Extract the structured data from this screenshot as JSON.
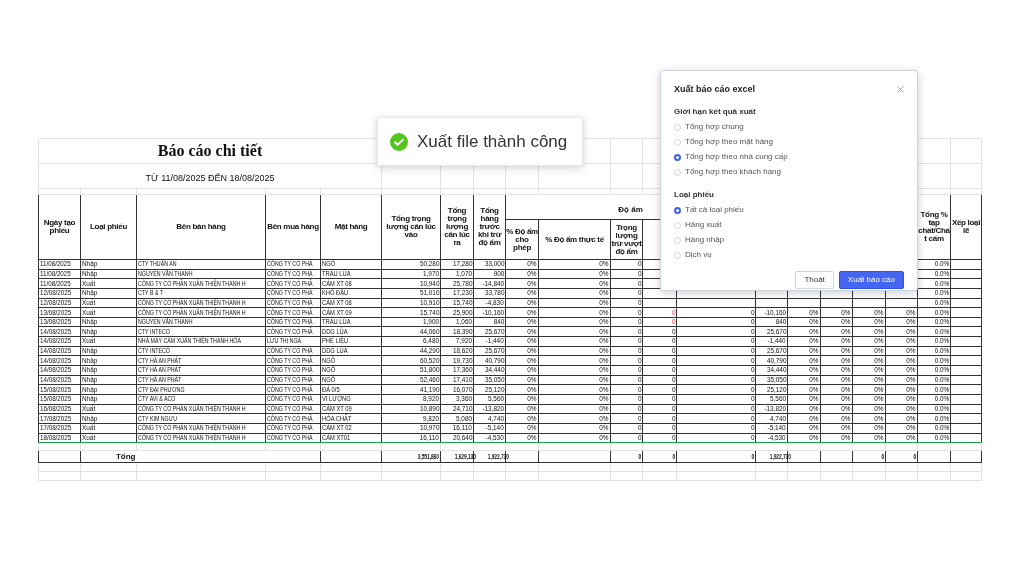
{
  "report": {
    "title": "Báo cáo chi tiết",
    "subtitle": "TỪ 11/08/2025 ĐẾN 18/08/2025",
    "group_header": "Độ ẩm",
    "columns": [
      "Ngày tạo phiếu",
      "Loại phiếu",
      "Bên bán hàng",
      "Bên mua hàng",
      "Mặt hàng",
      "Tổng trọng lượng cân lúc vào",
      "Tổng trọng lượng cân lúc ra",
      "Tổng hàng trước khi trừ độ ẩm",
      "% Độ ẩm cho phép",
      "% Độ ẩm thực tế",
      "Trọng lượng trừ vượt độ ẩm",
      null,
      null,
      null,
      null,
      null,
      null,
      null,
      "Tổng % tạp chất/Chất cấm",
      "Xếp loại lẽ"
    ],
    "rows": [
      {
        "cells": [
          "11/08/2025",
          "Nhập",
          "CTY THUẬN AN",
          "CÔNG TY CỔ PHẦ",
          "NGÔ",
          "50,280",
          "17,280",
          "33,000",
          "0%",
          "0%",
          "0",
          null,
          null,
          null,
          null,
          null,
          null,
          null,
          "0.0%"
        ]
      },
      {
        "cells": [
          "11/08/2025",
          "Nhập",
          "NGUYỄN VĂN THANH",
          "CÔNG TY CỔ PHẦ",
          "TRẤU LÚA",
          "1,970",
          "1,070",
          "900",
          "0%",
          "0%",
          "0",
          null,
          null,
          null,
          null,
          null,
          null,
          null,
          "0.0%"
        ]
      },
      {
        "cells": [
          "11/08/2025",
          "Xuất",
          "CÔNG TY CỔ PHẦN XUÂN THIỆN THANH H",
          "CÔNG TY CỔ PHẦ",
          "CÁM XT 08",
          "10,940",
          "25,780",
          "-14,840",
          "0%",
          "0%",
          "0",
          null,
          null,
          null,
          null,
          null,
          null,
          null,
          "0.0%"
        ]
      },
      {
        "cells": [
          "12/08/2025",
          "Nhập",
          "CTY B & T",
          "CÔNG TY CỔ PHẦ",
          "KHÔ ĐẬU",
          "51,010",
          "17,230",
          "33,780",
          "0%",
          "0%",
          "0",
          null,
          null,
          null,
          null,
          null,
          null,
          null,
          "0.0%"
        ]
      },
      {
        "cells": [
          "12/08/2025",
          "Xuất",
          "CÔNG TY CỔ PHẦN XUÂN THIỆN THANH H",
          "CÔNG TY CỔ PHẦ",
          "CÁM XT 08",
          "10,910",
          "15,740",
          "-4,830",
          "0%",
          "0%",
          "0",
          null,
          null,
          null,
          null,
          null,
          null,
          null,
          "0.0%"
        ]
      },
      {
        "warning": true,
        "cells": [
          "13/08/2025",
          "Xuất",
          "CÔNG TY CỔ PHẦN XUÂN THIỆN THANH H",
          "CÔNG TY CỔ PHẦ",
          "CÁM XT 09",
          "15,740",
          "25,900",
          "-10,160",
          "0%",
          "0%",
          "0",
          "0",
          "0",
          "-10,160",
          "0%",
          "0%",
          "0%",
          "0%",
          "0.0%"
        ]
      },
      {
        "warning": true,
        "cells": [
          "13/08/2025",
          "Nhập",
          "NGUYỄN VĂN THANH",
          "CÔNG TY CỔ PHẦ",
          "TRẤU LÚA",
          "1,900",
          "1,060",
          "840",
          "0%",
          "0%",
          "0",
          "0",
          "0",
          "840",
          "0%",
          "0%",
          "0%",
          "0%",
          "0.0%"
        ]
      },
      {
        "warning": false,
        "cells": [
          "14/08/2025",
          "Nhập",
          "CTY INTECO",
          "CÔNG TY CỔ PHẦ",
          "DDG LÚA",
          "44,060",
          "18,390",
          "25,670",
          "0%",
          "0%",
          "0",
          "0",
          "0",
          "25,670",
          "0%",
          "0%",
          "0%",
          "0%",
          "0.0%"
        ]
      },
      {
        "warning": false,
        "cells": [
          "14/08/2025",
          "Xuất",
          "NHÀ MÁY CÁM XUÂN THIỆN THANH HÓA",
          "LƯU THỊ NGA",
          "PHẾ LIỆU",
          "6,480",
          "7,920",
          "-1,440",
          "0%",
          "0%",
          "0",
          "0",
          "0",
          "-1,440",
          "0%",
          "0%",
          "0%",
          "0%",
          "0.0%"
        ]
      },
      {
        "warning": false,
        "cells": [
          "14/08/2025",
          "Nhập",
          "CTY INTECO",
          "CÔNG TY CỔ PHẦ",
          "DDG LÚA",
          "44,290",
          "18,620",
          "25,670",
          "0%",
          "0%",
          "0",
          "0",
          "0",
          "25,670",
          "0%",
          "0%",
          "0%",
          "0%",
          "0.0%"
        ]
      },
      {
        "warning": false,
        "cells": [
          "14/08/2025",
          "Nhập",
          "CTY HÀ AN PHÁT",
          "CÔNG TY CỔ PHẦ",
          "NGÔ",
          "60,520",
          "19,730",
          "40,790",
          "0%",
          "0%",
          "0",
          "0",
          "0",
          "40,790",
          "0%",
          "0%",
          "0%",
          "0%",
          "0.0%"
        ]
      },
      {
        "warning": false,
        "cells": [
          "14/08/2025",
          "Nhập",
          "CTY HÀ AN PHÁT",
          "CÔNG TY CỔ PHẦ",
          "NGÔ",
          "51,800",
          "17,360",
          "34,440",
          "0%",
          "0%",
          "0",
          "0",
          "0",
          "34,440",
          "0%",
          "0%",
          "0%",
          "0%",
          "0.0%"
        ]
      },
      {
        "warning": false,
        "cells": [
          "14/08/2025",
          "Nhập",
          "CTY HÀ AN PHÁT",
          "CÔNG TY CỔ PHẦ",
          "NGÔ",
          "52,460",
          "17,410",
          "35,050",
          "0%",
          "0%",
          "0",
          "0",
          "0",
          "35,050",
          "0%",
          "0%",
          "0%",
          "0%",
          "0.0%"
        ]
      },
      {
        "warning": false,
        "cells": [
          "15/08/2025",
          "Nhập",
          "CTY ĐẠI PHƯƠNG",
          "CÔNG TY CỔ PHẦ",
          "ĐÁ 0/5",
          "41,190",
          "16,070",
          "25,120",
          "0%",
          "0%",
          "0",
          "0",
          "0",
          "25,120",
          "0%",
          "0%",
          "0%",
          "0%",
          "0.0%"
        ]
      },
      {
        "warning": false,
        "cells": [
          "15/08/2025",
          "Nhập",
          "CTY AVI & ACO",
          "CÔNG TY CỔ PHẦ",
          "VI LƯỢNG",
          "8,920",
          "3,360",
          "5,560",
          "0%",
          "0%",
          "0",
          "0",
          "0",
          "5,560",
          "0%",
          "0%",
          "0%",
          "0%",
          "0.0%"
        ]
      },
      {
        "warning": false,
        "cells": [
          "16/08/2025",
          "Xuất",
          "CÔNG TY CỔ PHẦN XUÂN THIỆN THANH H",
          "CÔNG TY CỔ PHẦ",
          "CÁM XT 09",
          "10,890",
          "24,710",
          "-13,820",
          "0%",
          "0%",
          "0",
          "0",
          "0",
          "-13,820",
          "0%",
          "0%",
          "0%",
          "0%",
          "0.0%"
        ]
      },
      {
        "warning": false,
        "cells": [
          "17/08/2025",
          "Nhập",
          "CTY KIM NGƯU",
          "CÔNG TY CỔ PHẦ",
          "HÓA CHẤT",
          "9,820",
          "5,080",
          "4,740",
          "0%",
          "0%",
          "0",
          "0",
          "0",
          "4,740",
          "0%",
          "0%",
          "0%",
          "0%",
          "0.0%"
        ]
      },
      {
        "warning": false,
        "cells": [
          "17/08/2025",
          "Xuất",
          "CÔNG TY CỔ PHẦN XUÂN THIỆN THANH H",
          "CÔNG TY CỔ PHẦ",
          "CÁM XT 02",
          "10,970",
          "16,110",
          "-5,140",
          "0%",
          "0%",
          "0",
          "0",
          "0",
          "-5,140",
          "0%",
          "0%",
          "0%",
          "0%",
          "0.0%"
        ]
      },
      {
        "warning": false,
        "cells": [
          "18/08/2025",
          "Xuất",
          "CÔNG TY CỔ PHẦN XUÂN THIỆN THANH H",
          "CÔNG TY CỔ PHẦ",
          "CÁM XT01",
          "16,110",
          "20,640",
          "-4,530",
          "0%",
          "0%",
          "0",
          "0",
          "0",
          "-4,530",
          "0%",
          "0%",
          "0%",
          "0%",
          "0.0%"
        ]
      }
    ],
    "total": {
      "label": "Tổng",
      "cells": [
        null,
        null,
        null,
        null,
        null,
        "3,551,860",
        "1,629,130",
        "1,922,730",
        null,
        null,
        "0",
        "0",
        "0",
        "1,922,730",
        null,
        null,
        "0",
        "0"
      ]
    }
  },
  "toast": {
    "message": "Xuất file thành công"
  },
  "dialog": {
    "title": "Xuất báo cáo excel",
    "groups": [
      {
        "label": "Giới hạn kết quả xuất",
        "options": [
          {
            "label": "Tổng hợp chung",
            "selected": false
          },
          {
            "label": "Tổng hợp theo mặt hàng",
            "selected": false
          },
          {
            "label": "Tổng hợp theo nhà cung cấp",
            "selected": true
          },
          {
            "label": "Tổng hợp theo khách hàng",
            "selected": false
          }
        ]
      },
      {
        "label": "Loại phiếu",
        "options": [
          {
            "label": "Tất cả loại phiếu",
            "selected": true
          },
          {
            "label": "Hàng xuất",
            "selected": false
          },
          {
            "label": "Hàng nhập",
            "selected": false
          },
          {
            "label": "Dịch vụ",
            "selected": false
          }
        ]
      }
    ],
    "buttons": [
      {
        "label": "Thoát",
        "kind": "secondary"
      },
      {
        "label": "Xuất báo cáo",
        "kind": "primary"
      }
    ]
  }
}
